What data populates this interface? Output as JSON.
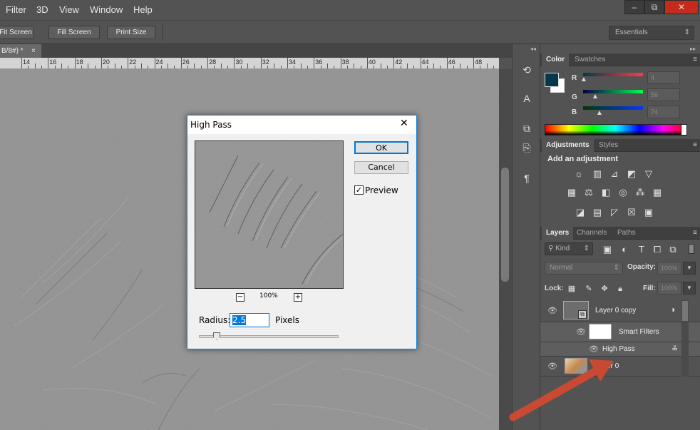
{
  "menubar": {
    "items": [
      "Filter",
      "3D",
      "View",
      "Window",
      "Help"
    ]
  },
  "window_controls": {
    "minimize": "–",
    "restore": "⧉",
    "close": "✕"
  },
  "options_bar": {
    "fit_screen": "Fit Screen",
    "fill_screen": "Fill Screen",
    "print_size": "Print Size",
    "workspace": "Essentials"
  },
  "document_tab": {
    "title": "B/8#) *",
    "close": "×"
  },
  "ruler": {
    "labels": [
      "14",
      "16",
      "18",
      "20",
      "22",
      "24",
      "26",
      "28",
      "30",
      "32",
      "34",
      "36",
      "38",
      "40",
      "42",
      "44",
      "46",
      "48"
    ]
  },
  "color_panel": {
    "tabs": [
      "Color",
      "Swatches"
    ],
    "channels": [
      {
        "label": "R",
        "value": "4",
        "color": "#cc2a2a"
      },
      {
        "label": "G",
        "value": "56",
        "color": "#2ab02a"
      },
      {
        "label": "B",
        "value": "74",
        "color": "#2a3acc"
      }
    ],
    "foreground": "#04384a",
    "background": "#ffffff"
  },
  "adjustments_panel": {
    "tabs": [
      "Adjustments",
      "Styles"
    ],
    "heading": "Add an adjustment"
  },
  "layers_panel": {
    "tabs": [
      "Layers",
      "Channels",
      "Paths"
    ],
    "filter_kind": "Kind",
    "blend_mode": "Normal",
    "opacity_label": "Opacity:",
    "opacity_value": "100%",
    "lock_label": "Lock:",
    "fill_label": "Fill:",
    "fill_value": "100%",
    "layers": [
      {
        "name": "Layer 0 copy"
      },
      {
        "name": "Smart Filters"
      },
      {
        "name": "High Pass"
      },
      {
        "name": "Layer 0"
      }
    ]
  },
  "dialog": {
    "title": "High Pass",
    "close": "✕",
    "ok": "OK",
    "cancel": "Cancel",
    "preview_label": "Preview",
    "preview_checked": true,
    "zoom": "100%",
    "zoom_out": "−",
    "zoom_in": "+",
    "radius_label": "Radius:",
    "radius_value": "2.5",
    "radius_unit": "Pixels"
  },
  "annotation": {
    "arrow_color": "#c84a32"
  }
}
